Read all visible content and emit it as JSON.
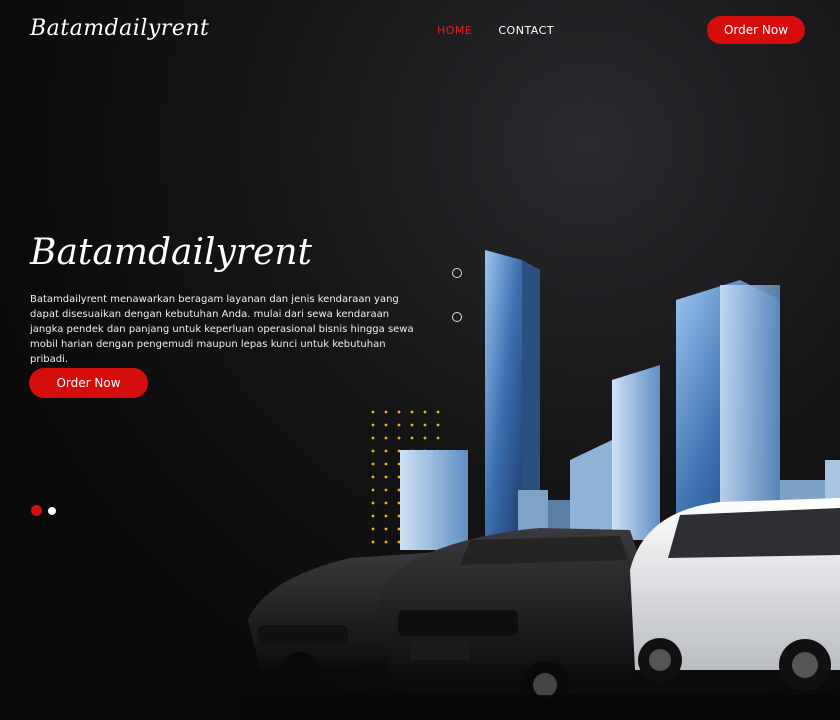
{
  "brand": {
    "logo": "Batamdailyrent"
  },
  "nav": {
    "items": [
      {
        "label": "HOME",
        "active": true
      },
      {
        "label": "CONTACT",
        "active": false
      }
    ]
  },
  "header": {
    "cta_label": "Order Now"
  },
  "hero": {
    "title": "Batamdailyrent",
    "description": "Batamdailyrent menawarkan beragam layanan dan jenis kendaraan yang dapat disesuaikan dengan kebutuhan Anda. mulai dari sewa kendaraan jangka pendek dan panjang untuk keperluan operasional bisnis hingga sewa mobil harian dengan pengemudi maupun lepas kunci untuk kebutuhan pribadi.",
    "cta_label": "Order Now"
  },
  "carousel": {
    "slides": 2,
    "active_index": 0
  },
  "colors": {
    "accent": "#d60d0d",
    "background": "#0b0b0d"
  }
}
